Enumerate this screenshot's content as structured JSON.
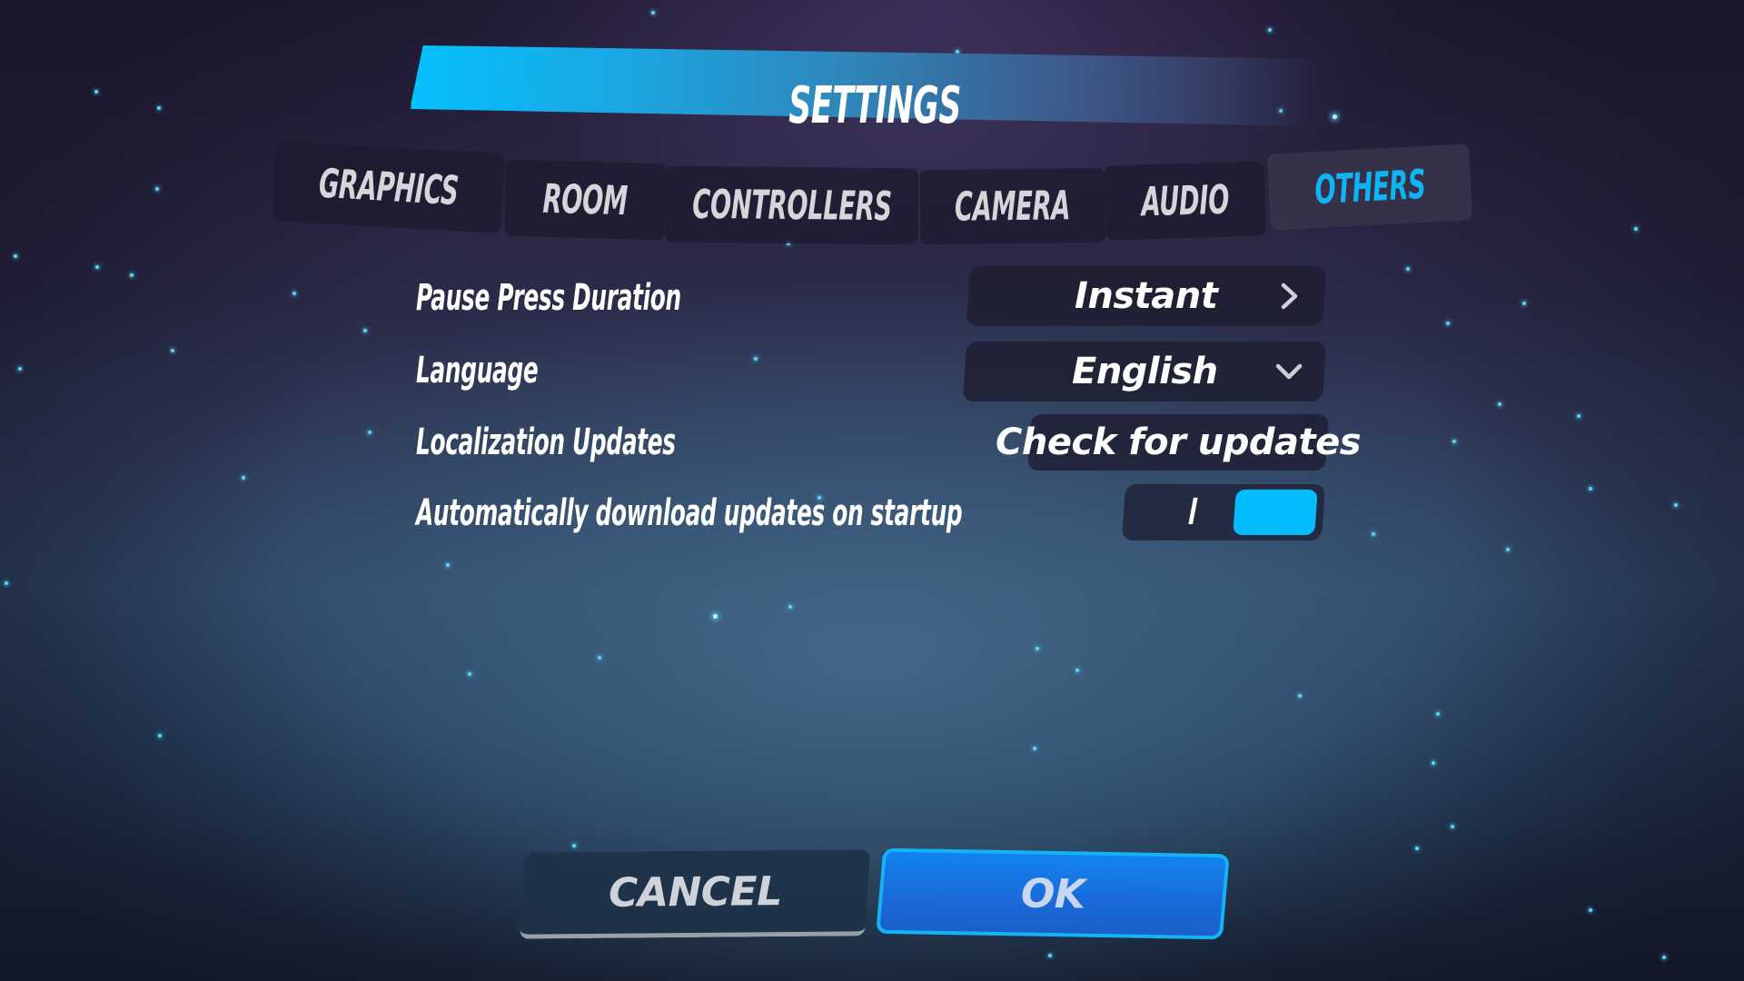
{
  "header": {
    "title": "SETTINGS"
  },
  "tabs": [
    {
      "id": "graphics",
      "label": "GRAPHICS",
      "active": false
    },
    {
      "id": "room",
      "label": "ROOM",
      "active": false
    },
    {
      "id": "controllers",
      "label": "CONTROLLERS",
      "active": false
    },
    {
      "id": "camera",
      "label": "CAMERA",
      "active": false
    },
    {
      "id": "audio",
      "label": "AUDIO",
      "active": false
    },
    {
      "id": "others",
      "label": "OTHERS",
      "active": true
    }
  ],
  "settings": {
    "pause_press_duration": {
      "label": "Pause Press Duration",
      "value": "Instant",
      "icon": "chevron-right-icon"
    },
    "language": {
      "label": "Language",
      "value": "English",
      "icon": "chevron-down-icon"
    },
    "localization_updates": {
      "label": "Localization Updates",
      "button_label": "Check for updates"
    },
    "auto_download": {
      "label": "Automatically download updates on startup",
      "state_mark": "I",
      "enabled": true
    }
  },
  "footer": {
    "cancel_label": "CANCEL",
    "ok_label": "OK"
  },
  "colors": {
    "accent": "#04bbfb",
    "active_tab_text": "#0fb4f4",
    "ok_button": "#1a6ad8",
    "ok_border": "#14b2f6",
    "tab_text": "#d5d5da"
  }
}
